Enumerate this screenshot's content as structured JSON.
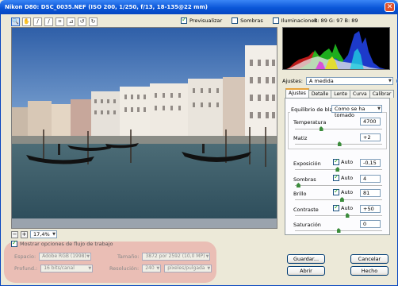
{
  "window": {
    "title": "Nikon D80:  DSC_0035.NEF   (ISO 200, 1/250, f/13, 18-135@22 mm)",
    "close_glyph": "✕"
  },
  "toolbar": {
    "tools": [
      "zoom-tool",
      "hand-tool",
      "white-balance-tool",
      "color-sampler-tool",
      "crop-tool",
      "straighten-tool",
      "rotate-left-tool",
      "rotate-right-tool"
    ],
    "glyphs": [
      "🔍",
      "✋",
      "∕",
      "∕",
      "⌗",
      "⊿",
      "↺",
      "↻"
    ]
  },
  "view_options": {
    "preview": {
      "label": "Previsualizar",
      "checked": true
    },
    "shadows": {
      "label": "Sombras",
      "checked": false
    },
    "highlights": {
      "label": "Iluminaciones",
      "checked": false
    }
  },
  "rgb_readout": "R:  89   G:  97   B:  89",
  "zoom": {
    "minus": "−",
    "plus": "+",
    "value": "17,4%"
  },
  "workflow": {
    "toggle_label": "Mostrar opciones de flujo de trabajo",
    "toggle_checked": true,
    "space_label": "Espacio:",
    "space_value": "Adobe RGB (1998)",
    "depth_label": "Profund.:",
    "depth_value": "16 bits/canal",
    "size_label": "Tamaño:",
    "size_value": "3872 por 2592  (10,0 MP)",
    "resolution_label": "Resolución:",
    "resolution_value": "240",
    "resolution_unit": "píxeles/pulgada"
  },
  "settings": {
    "label": "Ajustes:",
    "value": "A medida",
    "menu_glyph": "▸"
  },
  "tabs": [
    "Ajustes",
    "Detalle",
    "Lente",
    "Curva",
    "Calibrar"
  ],
  "adjustments": {
    "white_balance": {
      "label": "Equilibrio de blancos:",
      "value": "Como se ha tomado"
    },
    "temperature": {
      "label": "Temperatura",
      "value": "4700",
      "level": 0.3
    },
    "tint": {
      "label": "Matiz",
      "value": "+2",
      "level": 0.51
    },
    "exposure": {
      "label": "Exposición",
      "auto_label": "Auto",
      "auto": true,
      "value": "-0,15",
      "level": 0.49
    },
    "shadows": {
      "label": "Sombras",
      "auto_label": "Auto",
      "auto": true,
      "value": "4",
      "level": 0.04
    },
    "brightness": {
      "label": "Brillo",
      "auto_label": "Auto",
      "auto": true,
      "value": "81",
      "level": 0.54
    },
    "contrast": {
      "label": "Contraste",
      "auto_label": "Auto",
      "auto": true,
      "value": "+50",
      "level": 0.6
    },
    "saturation": {
      "label": "Saturación",
      "value": "0",
      "level": 0.5
    }
  },
  "buttons": {
    "save": "Guardar...",
    "open": "Abrir",
    "cancel": "Cancelar",
    "done": "Hecho"
  },
  "colors": {
    "titlebar": "#0A56D8",
    "panel_bg": "#ECE9D8",
    "highlight": "#E6505A",
    "slider_thumb": "#3C8C3C"
  }
}
